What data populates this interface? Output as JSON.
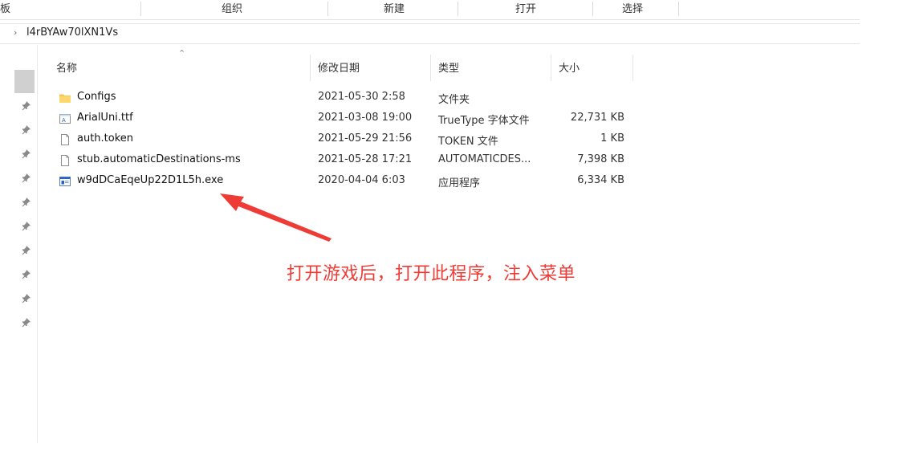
{
  "ribbon": {
    "groups": [
      {
        "label": "板"
      },
      {
        "label": "组织"
      },
      {
        "label": "新建"
      },
      {
        "label": "打开"
      },
      {
        "label": "选择"
      }
    ]
  },
  "address": {
    "crumb": "l4rBYAw70lXN1Vs"
  },
  "columns": {
    "name": "名称",
    "date": "修改日期",
    "type": "类型",
    "size": "大小"
  },
  "files": [
    {
      "name": "Configs",
      "date": "2021-05-30 2:58",
      "type": "文件夹",
      "size": "",
      "icon": "folder-icon"
    },
    {
      "name": "ArialUni.ttf",
      "date": "2021-03-08 19:00",
      "type": "TrueType 字体文件",
      "size": "22,731 KB",
      "icon": "font-file-icon"
    },
    {
      "name": "auth.token",
      "date": "2021-05-29 21:56",
      "type": "TOKEN 文件",
      "size": "1 KB",
      "icon": "file-icon"
    },
    {
      "name": "stub.automaticDestinations-ms",
      "date": "2021-05-28 17:21",
      "type": "AUTOMATICDES...",
      "size": "7,398 KB",
      "icon": "file-icon"
    },
    {
      "name": "w9dDCaEqeUp22D1L5h.exe",
      "date": "2020-04-04 6:03",
      "type": "应用程序",
      "size": "6,334 KB",
      "icon": "exe-icon"
    }
  ],
  "annotation": {
    "text": "打开游戏后，打开此程序，注入菜单",
    "color": "#ef3b36"
  },
  "colors": {
    "folder": "#f5c453",
    "selection": "#d0d0d0",
    "exe_blue": "#2a63c7"
  }
}
